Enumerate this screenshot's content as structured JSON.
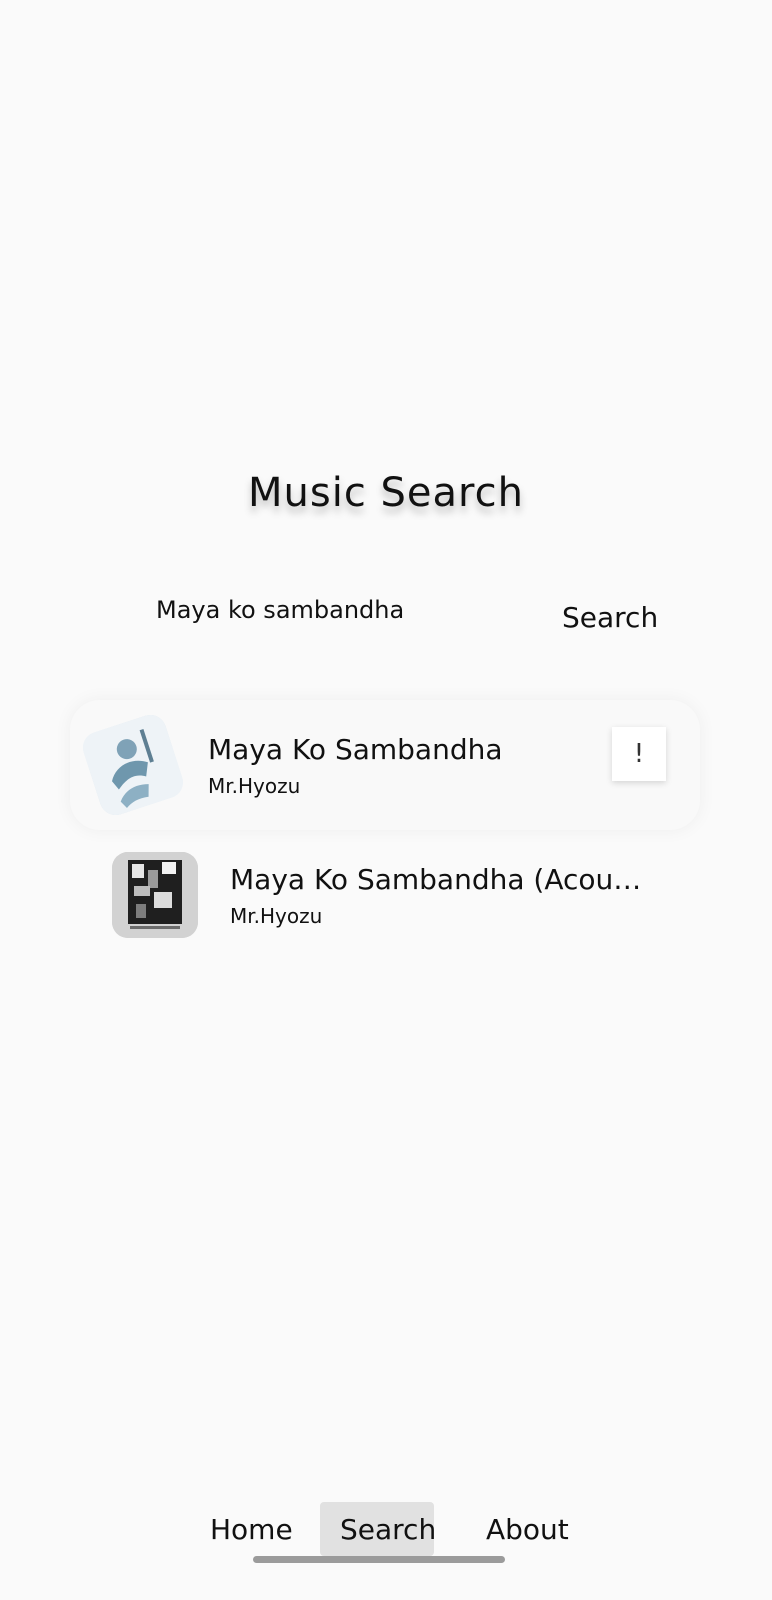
{
  "header": {
    "title": "Music Search"
  },
  "search": {
    "query": "Maya ko sambandha",
    "button_label": "Search"
  },
  "results": [
    {
      "title": "Maya Ko Sambandha",
      "artist": "Mr.Hyozu",
      "action_label": "!"
    },
    {
      "title": "Maya Ko Sambandha (Acoustic Intro...",
      "artist": "Mr.Hyozu"
    }
  ],
  "nav": {
    "items": [
      {
        "label": "Home"
      },
      {
        "label": "Search",
        "active": true
      },
      {
        "label": "About"
      }
    ]
  },
  "icons": {
    "cover_1": "album-art-silhouette-icon",
    "cover_2": "album-art-photo-icon"
  }
}
